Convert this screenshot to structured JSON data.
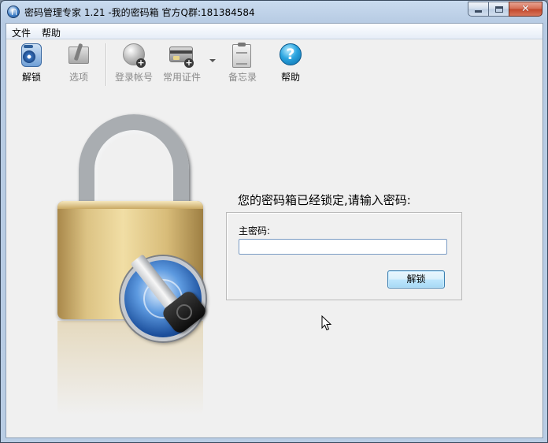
{
  "window": {
    "title": "密码管理专家 1.21 -我的密码箱 官方Q群:181384584",
    "controls": {
      "minimize": "",
      "maximize": "",
      "close": "✕"
    }
  },
  "menu": [
    {
      "label": "文件"
    },
    {
      "label": "帮助"
    }
  ],
  "toolbar": {
    "buttons": [
      {
        "label": "解锁",
        "icon": "unlock-vault-icon",
        "enabled": true
      },
      {
        "label": "选项",
        "icon": "options-toolbox-icon",
        "enabled": false
      },
      {
        "label": "登录帐号",
        "icon": "globe-add-icon",
        "enabled": false
      },
      {
        "label": "常用证件",
        "icon": "card-add-icon",
        "enabled": false
      },
      {
        "label": "备忘录",
        "icon": "memo-clipboard-icon",
        "enabled": false
      },
      {
        "label": "帮助",
        "icon": "help-icon",
        "enabled": true
      }
    ]
  },
  "lock_screen": {
    "message": "您的密码箱已经锁定,请输入密码:",
    "password_label": "主密码:",
    "password_value": "",
    "unlock_button": "解锁",
    "help_glyph": "?"
  },
  "colors": {
    "titlebar": "#c9dbef",
    "client_bg": "#f0f0f0",
    "disabled_text": "#8a8a8a",
    "button_border": "#3c7fb1",
    "close_button": "#c2462a"
  }
}
